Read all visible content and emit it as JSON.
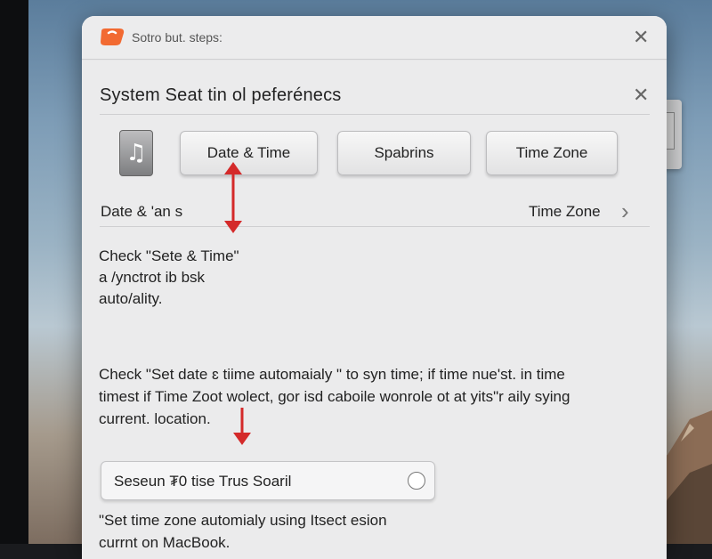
{
  "dialog": {
    "title": "Sotro but. steps:",
    "close_icon": "close-icon"
  },
  "panel": {
    "title": "System Seat tin ol peferénecs",
    "close_icon": "close-icon",
    "tabs": [
      {
        "label": "Date & Time"
      },
      {
        "label": "Spabrins"
      },
      {
        "label": "Time Zone"
      }
    ],
    "row": {
      "left": "Date & 'an  s",
      "right": "Time Zone"
    },
    "para1": [
      "Check \"Sete & Time\"",
      "a /ynctrot ib bsk",
      "auto/ality."
    ],
    "para2": [
      "Check \"Set date ɛ tiime automaialy \" to syn time; if time nue'st. in time",
      "timest  if  Time Zoot wolect, gor isd caboile wonrole ot at yits\"r aily sying",
      "current. location."
    ],
    "option": {
      "label": "Seseun ₮0 tise Trus Soaril",
      "selected": false
    },
    "para3": [
      "\"Set time zone automialy using Itsect  esion",
      "currnt on MacBook."
    ]
  },
  "colors": {
    "accent_arrow": "#d42a2a",
    "app_icon": "#f26a32"
  }
}
